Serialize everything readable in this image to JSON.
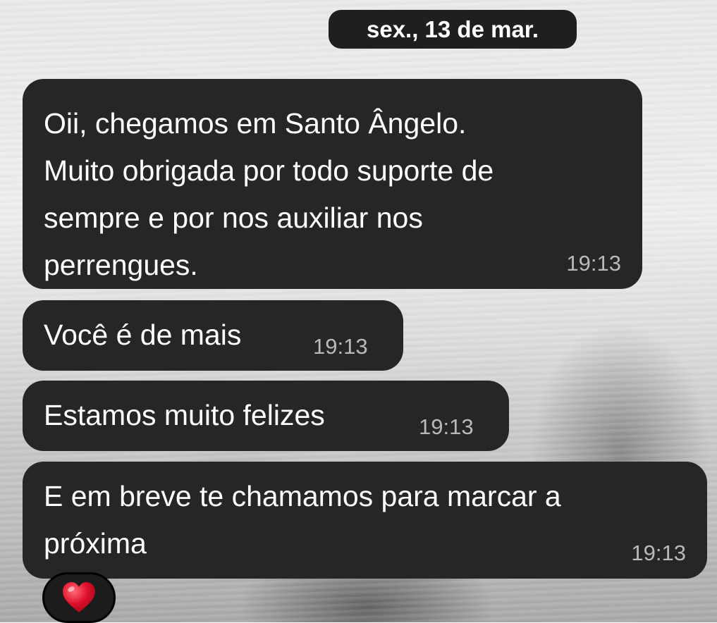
{
  "chat": {
    "date_separator": "sex., 13 de mar.",
    "messages": [
      {
        "text": "Oii, chegamos em Santo Ângelo.\nMuito obrigada por todo suporte de\nsempre e por nos auxiliar nos\nperrengues.",
        "time": "19:13"
      },
      {
        "text": "Você é de mais",
        "time": "19:13"
      },
      {
        "text": "Estamos muito felizes",
        "time": "19:13"
      },
      {
        "text": "E em breve te chamamos para marcar a\npróxima",
        "time": "19:13"
      }
    ],
    "reaction": {
      "icon": "red-heart-icon",
      "color": "#e0102a"
    },
    "bubble_color": "#262626",
    "text_color": "#ffffff",
    "timestamp_color": "#b9b9b9"
  }
}
